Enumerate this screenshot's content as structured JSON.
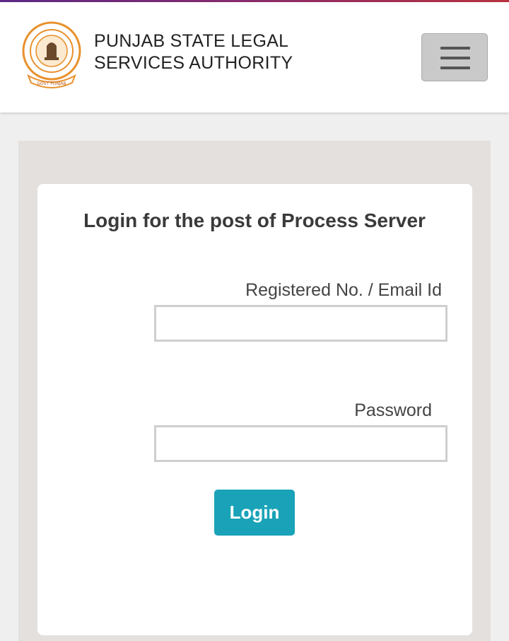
{
  "header": {
    "org_line1": "PUNJAB STATE LEGAL",
    "org_line2": "SERVICES AUTHORITY",
    "logo": {
      "icon": "punjab-emblem-icon",
      "ring_color": "#e8912d"
    },
    "menu_icon": "hamburger-icon"
  },
  "login": {
    "title": "Login for the post of Process Server",
    "username_label": "Registered No. / Email Id",
    "username_value": "",
    "password_label": "Password",
    "password_value": "",
    "submit_label": "Login"
  },
  "colors": {
    "accent": "#1aa3b8",
    "top_bar_start": "#5b2a86",
    "top_bar_end": "#b8323f"
  }
}
